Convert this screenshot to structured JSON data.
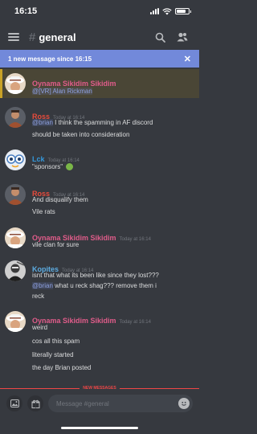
{
  "status_bar": {
    "time": "16:15"
  },
  "header": {
    "channel": "general",
    "hash": "#"
  },
  "banner": {
    "text": "1 new message since 16:15",
    "close": "✕"
  },
  "messages": [
    {
      "author": "Oynama Sikidim Sikidim",
      "time": "",
      "lines": [
        "@[VR] Alan Rickman"
      ],
      "color": "#e05c8a",
      "highlighted": true
    },
    {
      "author": "Ross",
      "time": "Today at 16:14",
      "lines": [
        "@brian I think the spamming in AF discord",
        "should be taken into consideration"
      ],
      "color": "#e74c3c"
    },
    {
      "author": "Lck",
      "time": "Today at 16:14",
      "lines": [
        "\"sponsors\""
      ],
      "color": "#3498db"
    },
    {
      "author": "Ross",
      "time": "Today at 16:14",
      "lines": [
        "And disqualify them",
        "Vile rats"
      ],
      "color": "#e74c3c"
    },
    {
      "author": "Oynama Sikidim Sikidim",
      "time": "Today at 16:14",
      "lines": [
        "vile clan for sure"
      ],
      "color": "#e05c8a"
    },
    {
      "author": "Kopites",
      "time": "Today at 16:14",
      "lines": [
        "isnt that what its been like since they lost???",
        "@brian what u reck shag??? remove them i",
        "reck"
      ],
      "color": "#5dade2"
    },
    {
      "author": "Oynama Sikidim Sikidim",
      "time": "Today at 16:14",
      "lines": [
        "weird",
        "cos all this spam",
        "literally started",
        "the day Brian posted"
      ],
      "color": "#e05c8a"
    }
  ],
  "divider": {
    "label": "NEW MESSAGES"
  },
  "composer": {
    "placeholder": "Message #general"
  },
  "colors": {
    "background": "#36393f",
    "banner": "#7289da",
    "new_messages": "#f04747",
    "highlight_bar": "#c9a227"
  },
  "icons": [
    "hamburger-icon",
    "search-icon",
    "members-icon",
    "close-icon",
    "image-icon",
    "gift-icon",
    "emoji-icon"
  ]
}
